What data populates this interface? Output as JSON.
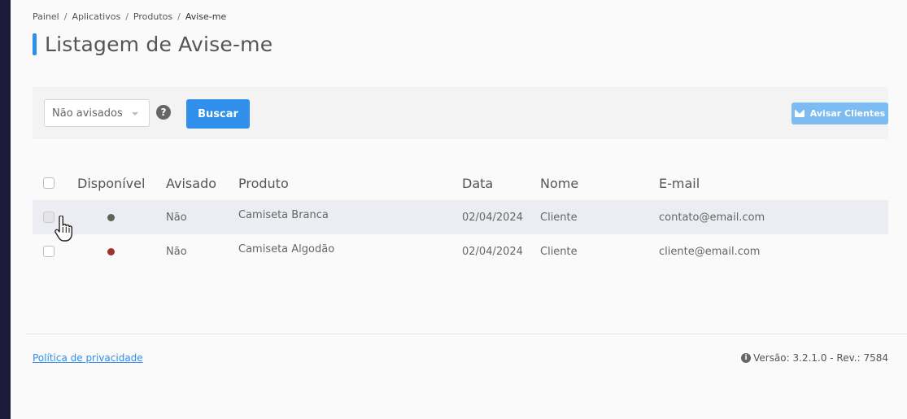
{
  "breadcrumb": [
    "Painel",
    "Aplicativos",
    "Produtos",
    "Avise-me"
  ],
  "page_title": "Listagem de Avise-me",
  "filter": {
    "status_value": "Não avisados",
    "help_glyph": "?",
    "search_label": "Buscar",
    "notify_label": "Avisar Clientes"
  },
  "table": {
    "headers": {
      "disponivel": "Disponível",
      "avisado": "Avisado",
      "produto": "Produto",
      "data": "Data",
      "nome": "Nome",
      "email": "E-mail"
    },
    "rows": [
      {
        "disponivel_color": "#5e6456",
        "avisado": "Não",
        "produto": "Camiseta Branca",
        "data": "02/04/2024",
        "nome": "Cliente",
        "email": "contato@email.com"
      },
      {
        "disponivel_color": "#a0302a",
        "avisado": "Não",
        "produto": "Camiseta Algodão",
        "data": "02/04/2024",
        "nome": "Cliente",
        "email": "cliente@email.com"
      }
    ]
  },
  "footer": {
    "privacy_label": "Política de privacidade",
    "version_text": "Versão: 3.2.1.0 - Rev.: 7584"
  },
  "colors": {
    "accent": "#2f8fea",
    "sidebar": "#1b1a3a"
  }
}
